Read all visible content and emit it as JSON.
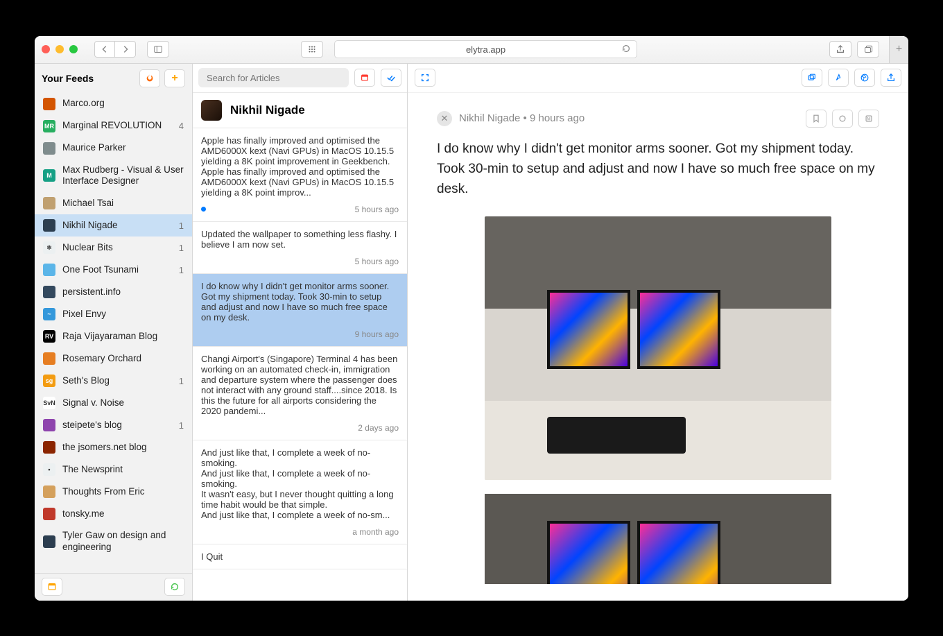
{
  "browser": {
    "url": "elytra.app"
  },
  "sidebar": {
    "title": "Your Feeds",
    "feeds": [
      {
        "name": "Marco.org",
        "badge": "",
        "color": "#d35400",
        "initials": ""
      },
      {
        "name": "Marginal REVOLUTION",
        "badge": "4",
        "color": "#27ae60",
        "initials": "MR"
      },
      {
        "name": "Maurice Parker",
        "badge": "",
        "color": "#7f8c8d",
        "initials": ""
      },
      {
        "name": "Max Rudberg - Visual & User Interface Designer",
        "badge": "",
        "color": "#16a085",
        "initials": "M"
      },
      {
        "name": "Michael Tsai",
        "badge": "",
        "color": "#c0a070",
        "initials": ""
      },
      {
        "name": "Nikhil Nigade",
        "badge": "1",
        "color": "#2c3e50",
        "initials": "",
        "active": true
      },
      {
        "name": "Nuclear Bits",
        "badge": "1",
        "color": "#ecf0f1",
        "initials": "⚛"
      },
      {
        "name": "One Foot Tsunami",
        "badge": "1",
        "color": "#5bb5e8",
        "initials": ""
      },
      {
        "name": "persistent.info",
        "badge": "",
        "color": "#34495e",
        "initials": ""
      },
      {
        "name": "Pixel Envy",
        "badge": "",
        "color": "#3498db",
        "initials": "~"
      },
      {
        "name": "Raja Vijayaraman Blog",
        "badge": "",
        "color": "#000",
        "initials": "RV"
      },
      {
        "name": "Rosemary Orchard",
        "badge": "",
        "color": "#e67e22",
        "initials": ""
      },
      {
        "name": "Seth's Blog",
        "badge": "1",
        "color": "#f39c12",
        "initials": "sg"
      },
      {
        "name": "Signal v. Noise",
        "badge": "",
        "color": "#fff",
        "initials": "SvN"
      },
      {
        "name": "steipete's blog",
        "badge": "1",
        "color": "#8e44ad",
        "initials": ""
      },
      {
        "name": "the jsomers.net blog",
        "badge": "",
        "color": "#8b2500",
        "initials": ""
      },
      {
        "name": "The Newsprint",
        "badge": "",
        "color": "#ecf0f1",
        "initials": "•"
      },
      {
        "name": "Thoughts From Eric",
        "badge": "",
        "color": "#d4a05c",
        "initials": ""
      },
      {
        "name": "tonsky.me",
        "badge": "",
        "color": "#c0392b",
        "initials": ""
      },
      {
        "name": "Tyler Gaw on design and engineering",
        "badge": "",
        "color": "#2c3e50",
        "initials": ""
      }
    ]
  },
  "articlesPane": {
    "search_placeholder": "Search for Articles",
    "feed_title": "Nikhil Nigade",
    "items": [
      {
        "excerpt": "Apple has finally improved and optimised the AMD6000X kext (Navi GPUs) in MacOS 10.15.5 yielding a 8K point improvement in Geekbench. Apple has finally improved and optimised the AMD6000X kext (Navi GPUs) in MacOS 10.15.5 yielding a 8K point improv...",
        "ts": "5 hours ago",
        "unread": true
      },
      {
        "excerpt": "Updated the wallpaper to something less flashy. I believe I am now set.",
        "ts": "5 hours ago"
      },
      {
        "excerpt": "I do know why I didn't get monitor arms sooner. Got my shipment today. Took 30-min to setup and adjust and now I have so much free space on my desk.",
        "ts": "9 hours ago",
        "selected": true
      },
      {
        "excerpt": "Changi Airport's (Singapore) Terminal 4 has been working on an automated check-in, immigration and departure system where the passenger does not interact with any ground staff....since 2018. Is this the future for all airports considering the 2020 pandemi...",
        "ts": "2 days ago"
      },
      {
        "excerpt": "And just like that, I complete a week of no-smoking.\nAnd just like that, I complete a week of no-smoking.\nIt wasn't easy, but I never thought quitting a long time habit would be that simple.\nAnd just like that, I complete a week of no-sm...",
        "ts": "a month ago"
      },
      {
        "excerpt": "I Quit",
        "ts": ""
      }
    ]
  },
  "reader": {
    "author": "Nikhil Nigade",
    "sep": "•",
    "time": "9 hours ago",
    "body": "I do know why I didn't get monitor arms sooner. Got my shipment today. Took 30-min to setup and adjust and now I have so much free space on my desk."
  }
}
